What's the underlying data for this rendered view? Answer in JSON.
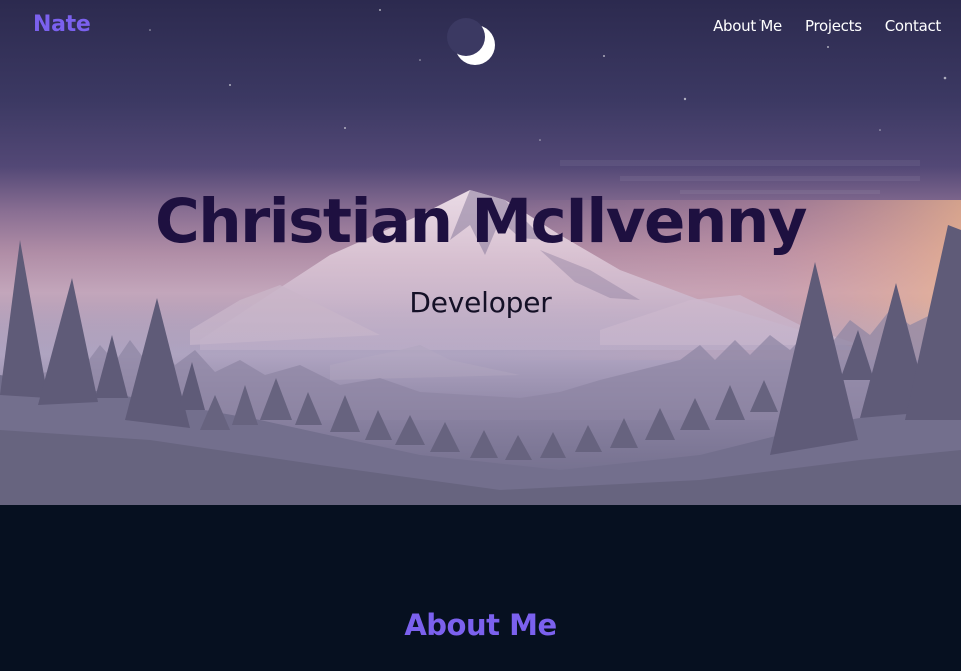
{
  "navbar": {
    "brand": "Nate",
    "links": [
      "About Me",
      "Projects",
      "Contact"
    ]
  },
  "hero": {
    "name": "Christian McIlvenny",
    "role": "Developer"
  },
  "about": {
    "heading": "About Me"
  },
  "colors": {
    "accent": "#7b61ee",
    "hero_name": "#1e1040",
    "page_bg": "#061020",
    "nav_text": "#ffffff"
  },
  "icons": {
    "moon": "crescent-moon-icon"
  }
}
